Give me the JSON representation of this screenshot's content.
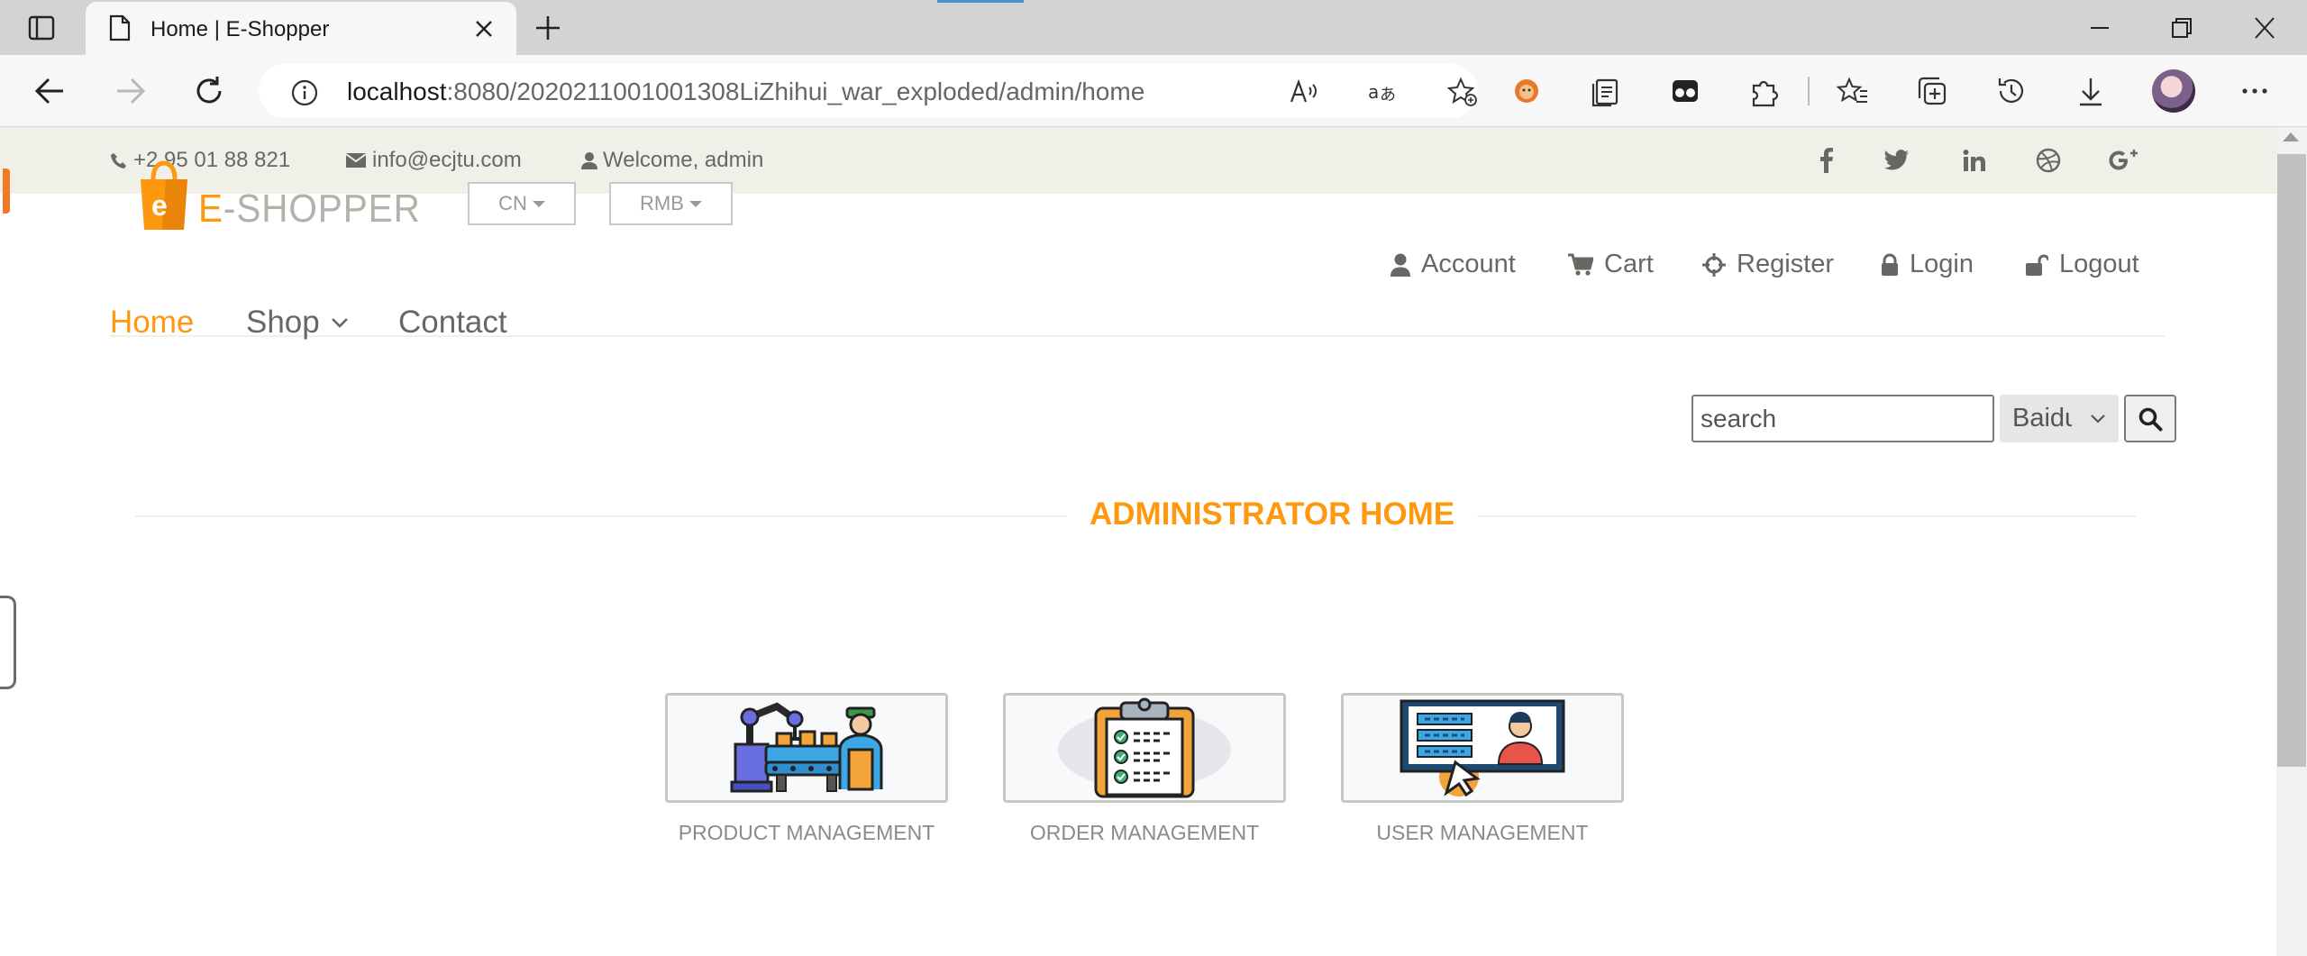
{
  "browser": {
    "tab_title": "Home | E-Shopper",
    "url_host": "localhost",
    "url_path": ":8080/2020211001001308LiZhihui_war_exploded/admin/home"
  },
  "header_top": {
    "phone": "+2 95 01 88 821",
    "email": "info@ecjtu.com",
    "welcome": "Welcome, admin",
    "social_icons": [
      "facebook-icon",
      "twitter-icon",
      "linkedin-icon",
      "dribbble-icon",
      "google-plus-icon"
    ]
  },
  "header_middle": {
    "logo_text": "E-SHOPPER",
    "language": "CN",
    "currency": "RMB",
    "account_links": {
      "account": "Account",
      "cart": "Cart",
      "register": "Register",
      "login": "Login",
      "logout": "Logout"
    }
  },
  "main_nav": {
    "home": "Home",
    "shop": "Shop",
    "contact": "Contact"
  },
  "search": {
    "value": "search",
    "engine": "Baidu"
  },
  "admin": {
    "title": "ADMINISTRATOR HOME",
    "cards": [
      {
        "label": "PRODUCT MANAGEMENT",
        "icon": "factory-assembly-icon"
      },
      {
        "label": "ORDER MANAGEMENT",
        "icon": "clipboard-checklist-icon"
      },
      {
        "label": "USER MANAGEMENT",
        "icon": "user-profile-screen-icon"
      }
    ]
  },
  "colors": {
    "accent": "#fe980f",
    "topbar_bg": "#f0f0e9",
    "text_gray": "#696763"
  }
}
